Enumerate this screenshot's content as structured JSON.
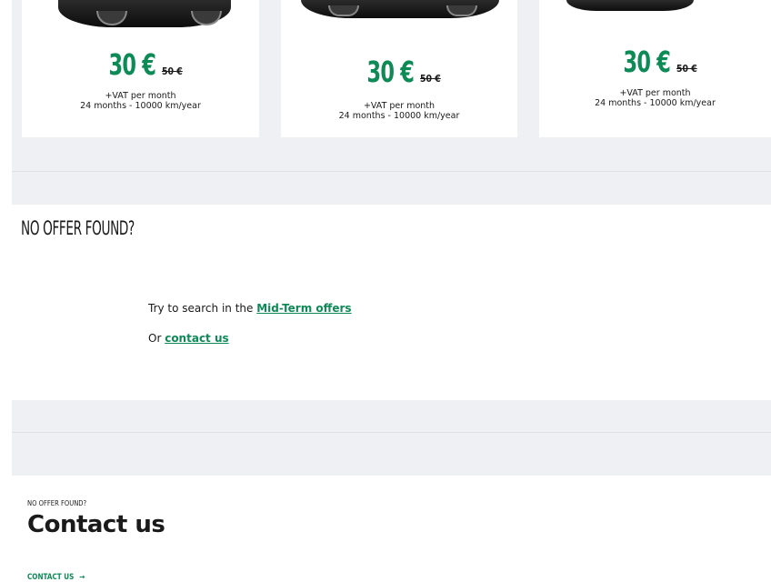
{
  "offers": [
    {
      "price": "30 €",
      "old_price": "50 €",
      "terms_line1": "+VAT per month",
      "terms_line2": "24 months - 10000 km/year"
    },
    {
      "price": "30 €",
      "old_price": "50 €",
      "terms_line1": "+VAT per month",
      "terms_line2": "24 months - 10000 km/year"
    },
    {
      "price": "30 €",
      "old_price": "50 €",
      "terms_line1": "+VAT per month",
      "terms_line2": "24 months - 10000 km/year"
    }
  ],
  "no_offer": {
    "title": "NO OFFER FOUND?",
    "search_prefix": "Try to search in the ",
    "search_link": "Mid-Term offers",
    "contact_prefix": "Or ",
    "contact_link": "contact us"
  },
  "contact": {
    "kicker": "NO OFFER FOUND?",
    "title": "Contact us",
    "link_label": "CONTACT US",
    "link_arrow": "→"
  },
  "colors": {
    "accent": "#0e8a57",
    "band": "#eff0f3"
  }
}
